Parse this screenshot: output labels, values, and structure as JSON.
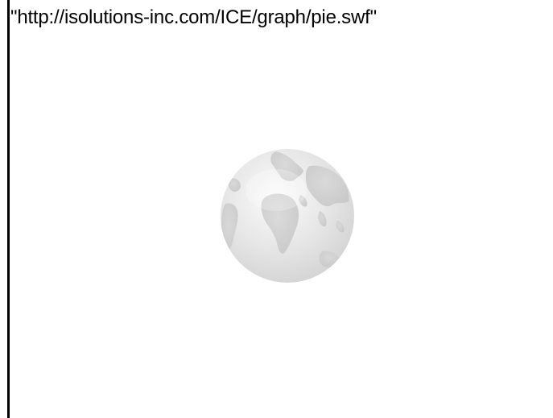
{
  "plugin": {
    "url_text": "\"http://isolutions-inc.com/ICE/graph/pie.swf\"",
    "placeholder_icon": "globe-icon",
    "colors": {
      "border": "#000000",
      "background": "#ffffff",
      "globe_light": "#f2f2f2",
      "globe_dark": "#d6d6d6"
    }
  }
}
